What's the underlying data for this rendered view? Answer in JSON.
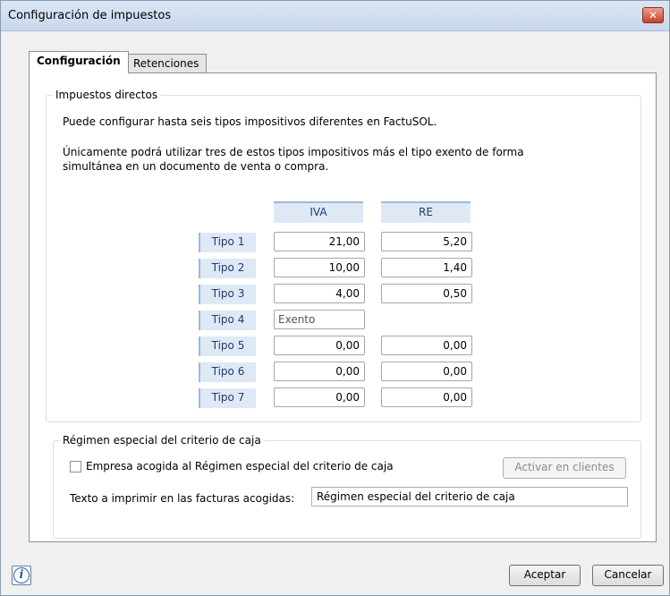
{
  "window": {
    "title": "Configuración de impuestos",
    "close_label": "✕"
  },
  "tabs": [
    {
      "label": "Configuración",
      "active": true
    },
    {
      "label": "Retenciones",
      "active": false
    }
  ],
  "direct_taxes": {
    "legend": "Impuestos directos",
    "line1": "Puede configurar hasta seis tipos impositivos diferentes en FactuSOL.",
    "line2": "Únicamente podrá utilizar tres de estos tipos impositivos más el tipo exento de forma",
    "line3": "simultánea en un documento de venta o compra.",
    "col_iva": "IVA",
    "col_re": "RE",
    "rows": [
      {
        "label": "Tipo 1",
        "iva": "21,00",
        "re": "5,20"
      },
      {
        "label": "Tipo 2",
        "iva": "10,00",
        "re": "1,40"
      },
      {
        "label": "Tipo 3",
        "iva": "4,00",
        "re": "0,50"
      },
      {
        "label": "Tipo 4",
        "iva": "Exento",
        "re": ""
      },
      {
        "label": "Tipo 5",
        "iva": "0,00",
        "re": "0,00"
      },
      {
        "label": "Tipo 6",
        "iva": "0,00",
        "re": "0,00"
      },
      {
        "label": "Tipo 7",
        "iva": "0,00",
        "re": "0,00"
      }
    ]
  },
  "cash_criteria": {
    "legend": "Régimen especial del criterio de caja",
    "checkbox_label": "Empresa acogida al Régimen especial del criterio de caja",
    "checkbox_checked": false,
    "activate_button": "Activar en clientes",
    "print_label": "Texto a imprimir en las facturas acogidas:",
    "print_value": "Régimen especial del criterio de caja"
  },
  "footer": {
    "info_icon": "info-icon",
    "accept_label": "Aceptar",
    "cancel_label": "Cancelar"
  },
  "colors": {
    "header_bg": "#dfe9f5",
    "header_text": "#1c3d6e",
    "close_red": "#c8412b"
  }
}
